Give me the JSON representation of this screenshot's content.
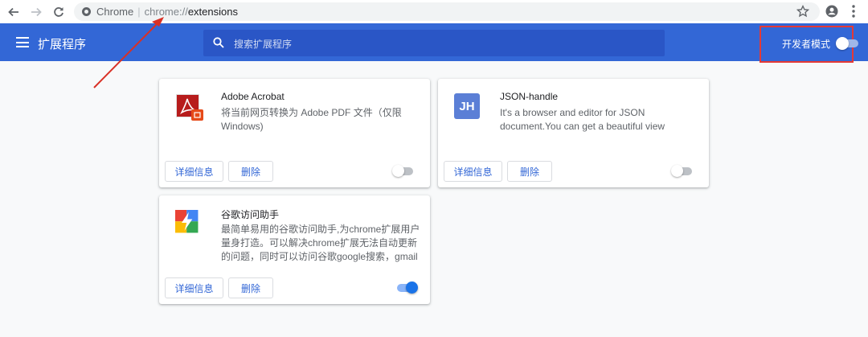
{
  "browser": {
    "chip_label": "Chrome",
    "url_scheme": "chrome://",
    "url_path": "extensions"
  },
  "header": {
    "title": "扩展程序",
    "search_placeholder": "搜索扩展程序",
    "dev_mode_label": "开发者模式",
    "dev_mode_on": false,
    "color": "#3367d6"
  },
  "extensions": [
    {
      "name": "Adobe Acrobat",
      "description": "将当前网页转换为 Adobe PDF 文件（仅限 Windows)",
      "details_label": "详细信息",
      "remove_label": "删除",
      "enabled": false,
      "icon": "adobe-acrobat-icon"
    },
    {
      "name": "JSON-handle",
      "description": "It's a browser and editor for JSON document.You can get a beautiful view",
      "details_label": "详细信息",
      "remove_label": "删除",
      "enabled": false,
      "icon": "json-handle-icon",
      "icon_text": "JH"
    },
    {
      "name": "谷歌访问助手",
      "description": "最简单易用的谷歌访问助手,为chrome扩展用户量身打造。可以解决chrome扩展无法自动更新的问题，同时可以访问谷歌google搜索，gmail邮箱,",
      "details_label": "详细信息",
      "remove_label": "删除",
      "enabled": true,
      "icon": "google-access-helper-icon"
    }
  ]
}
